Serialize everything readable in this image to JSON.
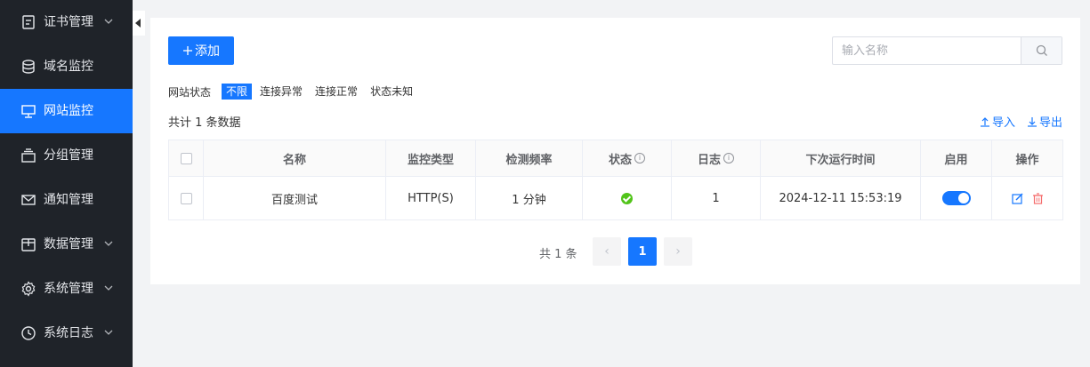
{
  "sidebar": {
    "items": [
      {
        "label": "证书管理",
        "icon": "certificate-icon",
        "has_chevron": true
      },
      {
        "label": "域名监控",
        "icon": "database-icon",
        "has_chevron": false
      },
      {
        "label": "网站监控",
        "icon": "monitor-icon",
        "has_chevron": false,
        "active": true
      },
      {
        "label": "分组管理",
        "icon": "layers-icon",
        "has_chevron": false
      },
      {
        "label": "通知管理",
        "icon": "mail-icon",
        "has_chevron": false
      },
      {
        "label": "数据管理",
        "icon": "box-icon",
        "has_chevron": true
      },
      {
        "label": "系统管理",
        "icon": "gear-icon",
        "has_chevron": true
      },
      {
        "label": "系统日志",
        "icon": "clock-icon",
        "has_chevron": true
      }
    ]
  },
  "toolbar": {
    "add_label": "添加"
  },
  "search": {
    "placeholder": "输入名称"
  },
  "filters": {
    "label": "网站状态",
    "options": [
      "不限",
      "连接异常",
      "连接正常",
      "状态未知"
    ],
    "selected": "不限"
  },
  "summary": {
    "total_text": "共计 1 条数据"
  },
  "actions": {
    "import_label": "导入",
    "export_label": "导出"
  },
  "table": {
    "headers": [
      "名称",
      "监控类型",
      "检测频率",
      "状态",
      "日志",
      "下次运行时间",
      "启用",
      "操作"
    ],
    "rows": [
      {
        "name": "百度测试",
        "type": "HTTP(S)",
        "frequency": "1 分钟",
        "status": "ok",
        "log_count": "1",
        "next_run": "2024-12-11 15:53:19",
        "enabled": true
      }
    ]
  },
  "pagination": {
    "total_text": "共 1 条",
    "current_page": "1"
  },
  "colors": {
    "primary": "#1677ff",
    "sidebar_bg": "#1f2329",
    "success": "#52c41a",
    "danger": "#f56c6c"
  }
}
